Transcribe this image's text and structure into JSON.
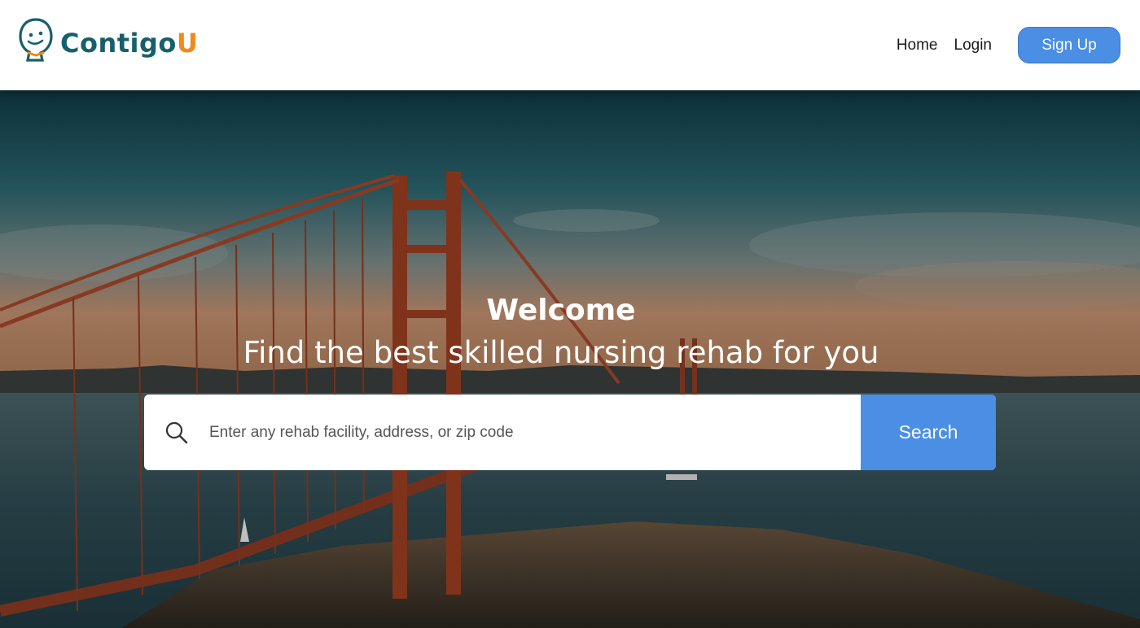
{
  "brand": {
    "name_main": "Contigo",
    "name_accent": "U",
    "primary_color": "#17606b",
    "accent_color": "#f08a1c"
  },
  "nav": {
    "home": "Home",
    "login": "Login",
    "signup": "Sign Up",
    "button_color": "#4a8fe4"
  },
  "hero": {
    "title": "Welcome",
    "subtitle": "Find the best skilled nursing rehab for you"
  },
  "search": {
    "placeholder": "Enter any rehab facility, address, or zip code",
    "value": "",
    "button_label": "Search",
    "icon": "search-icon"
  }
}
